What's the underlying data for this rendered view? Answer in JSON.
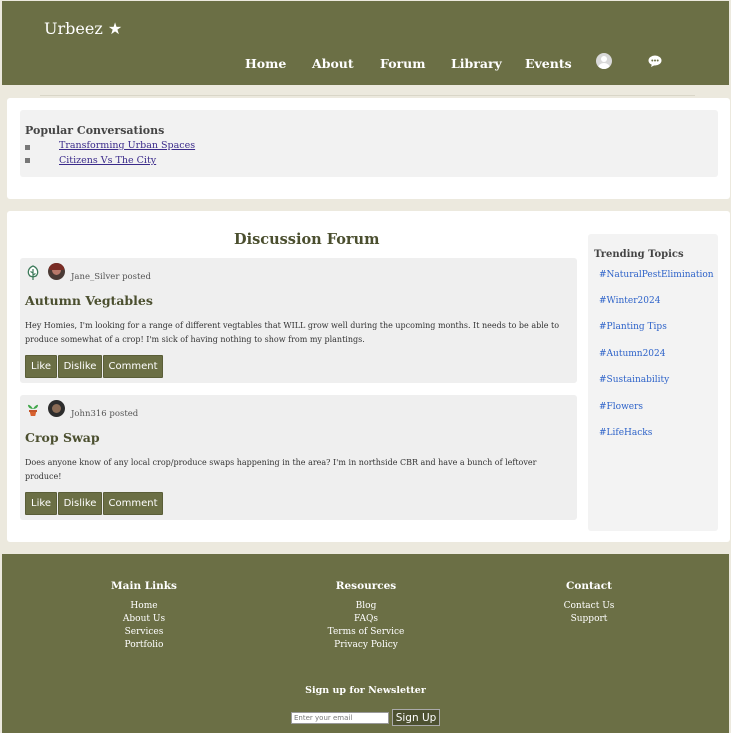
{
  "header": {
    "brand": "Urbeez ★",
    "nav": [
      "Home",
      "About",
      "Forum",
      "Library",
      "Events"
    ],
    "icons": [
      "user-avatar-icon",
      "chat-bubble-icon"
    ]
  },
  "popular": {
    "title": "Popular Conversations",
    "items": [
      "Transforming Urban Spaces",
      "Citizens Vs The City"
    ]
  },
  "forum": {
    "title": "Discussion Forum",
    "posts": [
      {
        "icon": "tree-icon",
        "author": "Jane_Silver posted",
        "title": "Autumn Vegtables",
        "body": "Hey Homies, I'm looking for a range of different vegtables that WILL grow well during the upcoming months. It needs to be able to produce somewhat of a crop! I'm sick of having nothing to show from my plantings.",
        "actions": [
          "Like",
          "Dislike",
          "Comment"
        ]
      },
      {
        "icon": "potted-plant-icon",
        "author": "John316 posted",
        "title": "Crop Swap",
        "body": "Does anyone know of any local crop/produce swaps happening in the area? I'm in northside CBR and have a bunch of leftover produce!",
        "actions": [
          "Like",
          "Dislike",
          "Comment"
        ]
      }
    ]
  },
  "trending": {
    "title": "Trending Topics",
    "items": [
      "#NaturalPestElimination",
      "#Winter2024",
      "#Planting Tips",
      "#Autumn2024",
      "#Sustainability",
      "#Flowers",
      "#LifeHacks"
    ]
  },
  "footer": {
    "columns": [
      {
        "heading": "Main Links",
        "links": [
          "Home",
          "About Us",
          "Services",
          "Portfolio"
        ]
      },
      {
        "heading": "Resources",
        "links": [
          "Blog",
          "FAQs",
          "Terms of Service",
          "Privacy Policy"
        ]
      },
      {
        "heading": "Contact",
        "links": [
          "Contact Us",
          "Support"
        ]
      }
    ],
    "newsletter_title": "Sign up for Newsletter",
    "email_placeholder": "Enter your email",
    "signup_label": "Sign Up"
  },
  "colors": {
    "brand": "#6b6f45",
    "background": "#ece9de",
    "link": "#2e63c9"
  }
}
